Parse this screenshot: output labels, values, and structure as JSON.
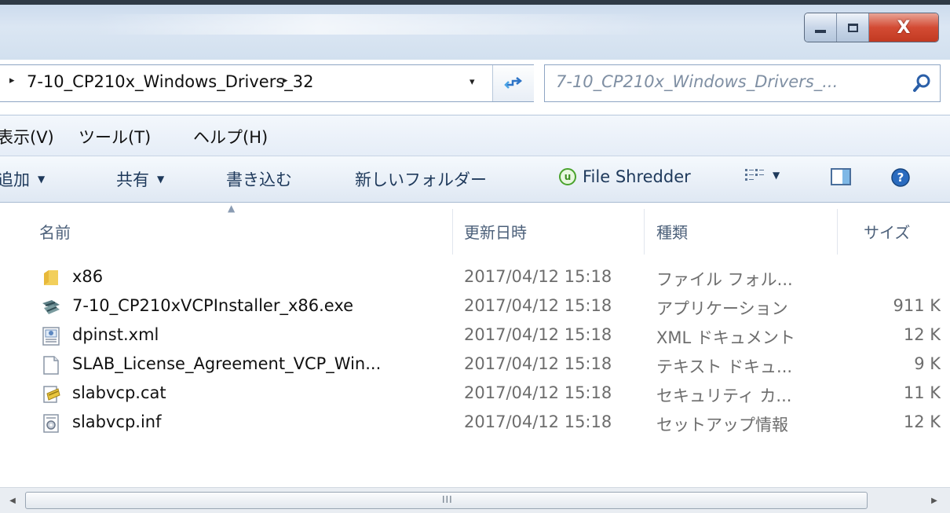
{
  "window": {
    "controls": {
      "minimize_icon": "minimize-icon",
      "maximize_icon": "maximize-icon",
      "close_glyph": "X"
    }
  },
  "address": {
    "breadcrumb": "7-10_CP210x_Windows_Drivers_32",
    "leading_arrow": "▸",
    "trailing_arrow": "▸",
    "dropdown_arrow": "▾"
  },
  "search": {
    "placeholder": "7-10_CP210x_Windows_Drivers_..."
  },
  "menu": {
    "items": [
      {
        "label": "表示(V)"
      },
      {
        "label": "ツール(T)"
      },
      {
        "label": "ヘルプ(H)"
      }
    ]
  },
  "toolbar": {
    "items": [
      {
        "label": "追加"
      },
      {
        "label": "共有"
      },
      {
        "label": "書き込む"
      },
      {
        "label": "新しいフォルダー"
      },
      {
        "label": "File Shredder"
      }
    ],
    "caret": "▼"
  },
  "columns": {
    "name": "名前",
    "modified": "更新日時",
    "type": "種類",
    "size": "サイズ"
  },
  "files": [
    {
      "name": "x86",
      "modified": "2017/04/12 15:18",
      "type": "ファイル フォル...",
      "size": "",
      "icon": "folder-icon"
    },
    {
      "name": "7-10_CP210xVCPInstaller_x86.exe",
      "modified": "2017/04/12 15:18",
      "type": "アプリケーション",
      "size": "911 K",
      "icon": "installer-icon"
    },
    {
      "name": "dpinst.xml",
      "modified": "2017/04/12 15:18",
      "type": "XML ドキュメント",
      "size": "12 K",
      "icon": "xml-file-icon"
    },
    {
      "name": "SLAB_License_Agreement_VCP_Win...",
      "modified": "2017/04/12 15:18",
      "type": "テキスト ドキュ...",
      "size": "9 K",
      "icon": "text-file-icon"
    },
    {
      "name": "slabvcp.cat",
      "modified": "2017/04/12 15:18",
      "type": "セキュリティ カ...",
      "size": "11 K",
      "icon": "security-catalog-icon"
    },
    {
      "name": "slabvcp.inf",
      "modified": "2017/04/12 15:18",
      "type": "セットアップ情報",
      "size": "12 K",
      "icon": "setup-info-icon"
    }
  ],
  "scrollbar": {
    "grip": "III"
  }
}
